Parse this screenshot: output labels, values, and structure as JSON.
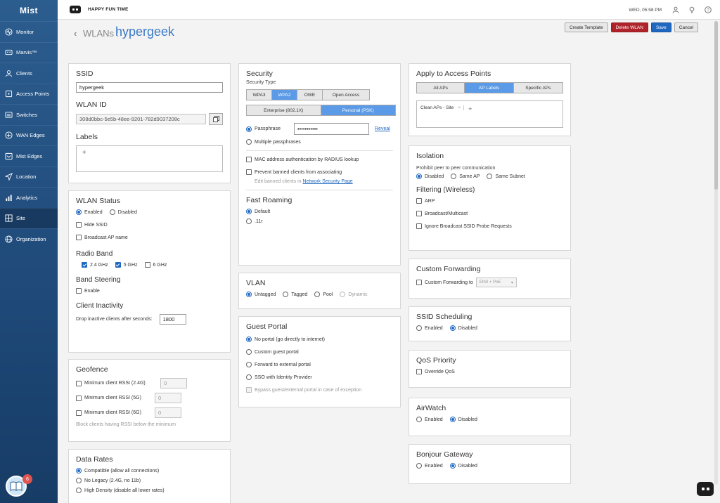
{
  "brand": "Mist",
  "sidebar": {
    "items": [
      {
        "label": "Monitor",
        "icon": "monitor-icon"
      },
      {
        "label": "Marvis™",
        "icon": "marvis-icon"
      },
      {
        "label": "Clients",
        "icon": "clients-icon"
      },
      {
        "label": "Access Points",
        "icon": "access-point-icon"
      },
      {
        "label": "Switches",
        "icon": "switch-icon"
      },
      {
        "label": "WAN Edges",
        "icon": "wan-edge-icon"
      },
      {
        "label": "Mist Edges",
        "icon": "mist-edge-icon"
      },
      {
        "label": "Location",
        "icon": "location-icon"
      },
      {
        "label": "Analytics",
        "icon": "analytics-icon"
      },
      {
        "label": "Site",
        "icon": "site-icon",
        "active": true
      },
      {
        "label": "Organization",
        "icon": "organization-icon"
      }
    ],
    "help_badge_count": "6"
  },
  "topbar": {
    "org_name": "HAPPY FUN TIME",
    "datetime": "WED, 05:58 PM"
  },
  "header": {
    "breadcrumb": "WLANs :",
    "title": "hypergeek",
    "buttons": {
      "create_template": "Create Template",
      "delete_wlan": "Delete WLAN",
      "save": "Save",
      "cancel": "Cancel"
    }
  },
  "ssid_panel": {
    "ssid_label": "SSID",
    "ssid_value": "hypergeek",
    "wlan_id_label": "WLAN ID",
    "wlan_id_value": "308d0bbc-5e5b-48ee-9201-782d9037208c",
    "labels_label": "Labels",
    "add": "+"
  },
  "status_panel": {
    "title": "WLAN Status",
    "enabled": "Enabled",
    "disabled": "Disabled",
    "hide_ssid": "Hide SSID",
    "broadcast_ap_name": "Broadcast AP name",
    "radio_band_title": "Radio Band",
    "band_24": "2.4 GHz",
    "band_5": "5 GHz",
    "band_6": "6 GHz",
    "band_steering_title": "Band Steering",
    "band_steering_enable": "Enable",
    "client_inactivity_title": "Client Inactivity",
    "drop_inactive_label": "Drop inactive clients after seconds:",
    "drop_inactive_value": "1800"
  },
  "geofence_panel": {
    "title": "Geofence",
    "rssi_24": "Minimum client RSSI (2.4G)",
    "rssi_5": "Minimum client RSSI (5G)",
    "rssi_6": "Minimum client RSSI (6G)",
    "rssi_value": "0",
    "note": "Block clients having RSSI below the minimum"
  },
  "data_rates_panel": {
    "title": "Data Rates",
    "compatible": "Compatible (allow all connections)",
    "no_legacy": "No Legacy (2.4G, no 11b)",
    "high_density": "High Density (disable all lower rates)"
  },
  "security_panel": {
    "title": "Security",
    "security_type_label": "Security Type",
    "types": [
      "WPA3",
      "WPA2",
      "OWE",
      "Open Access"
    ],
    "modes": [
      "Enterprise (802.1X)",
      "Personal (PSK)"
    ],
    "passphrase_label": "Passphrase",
    "passphrase_value": "•••••••••••",
    "reveal": "Reveal",
    "multiple_passphrases": "Multiple passphrases",
    "mac_auth": "MAC address authentication by RADIUS lookup",
    "prevent_banned": "Prevent banned clients from associating",
    "edit_banned_prefix": "Edit banned clients in",
    "network_security_page": "Network Security Page",
    "fast_roaming_title": "Fast Roaming",
    "default": "Default",
    "dot11r": ".11r"
  },
  "vlan_panel": {
    "title": "VLAN",
    "untagged": "Untagged",
    "tagged": "Tagged",
    "pool": "Pool",
    "dynamic": "Dynamic"
  },
  "guest_portal_panel": {
    "title": "Guest Portal",
    "no_portal": "No portal (go directly to internet)",
    "custom_portal": "Custom guest portal",
    "forward_external": "Forward to external portal",
    "sso": "SSO with Identity Provider",
    "bypass": "Bypass guest/external portal in case of exception"
  },
  "apply_panel": {
    "title": "Apply to Access Points",
    "tabs": [
      "All APs",
      "AP Labels",
      "Specific APs"
    ],
    "chip": "Clean APs - Site",
    "chip_remove": "×",
    "add": "+"
  },
  "isolation_panel": {
    "title": "Isolation",
    "prohibit_label": "Prohibit peer to peer communication",
    "disabled": "Disabled",
    "same_ap": "Same AP",
    "same_subnet": "Same Subnet",
    "filtering_title": "Filtering (Wireless)",
    "arp": "ARP",
    "broadcast_multicast": "Broadcast/Multicast",
    "ignore_probe": "Ignore Broadcast SSID Probe Requests"
  },
  "custom_forwarding_panel": {
    "title": "Custom Forwarding",
    "label": "Custom Forwarding to",
    "select_value": "Eth0 + PoE"
  },
  "ssid_scheduling_panel": {
    "title": "SSID Scheduling",
    "enabled": "Enabled",
    "disabled": "Disabled"
  },
  "qos_panel": {
    "title": "QoS Priority",
    "override": "Override QoS"
  },
  "airwatch_panel": {
    "title": "AirWatch",
    "enabled": "Enabled",
    "disabled": "Disabled"
  },
  "bonjour_panel": {
    "title": "Bonjour Gateway",
    "enabled": "Enabled",
    "disabled": "Disabled"
  },
  "colors": {
    "sidebar": "#1f4a7a",
    "accent_blue": "#1f67c0",
    "title_blue": "#3a7bc8",
    "delete_red": "#b0232a",
    "segment_active": "#5a9ae6"
  }
}
